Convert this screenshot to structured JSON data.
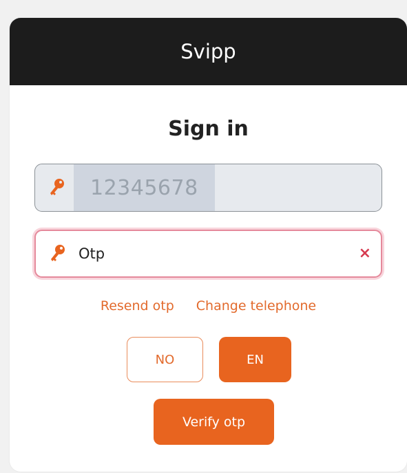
{
  "header": {
    "app_name": "Svipp"
  },
  "form": {
    "title": "Sign in",
    "phone_value": "12345678",
    "otp_placeholder": "Otp",
    "otp_value": "",
    "clear_symbol": "×"
  },
  "links": {
    "resend": "Resend otp",
    "change_phone": "Change telephone"
  },
  "language": {
    "options": [
      "NO",
      "EN"
    ],
    "selected": "EN"
  },
  "actions": {
    "verify_label": "Verify otp"
  },
  "icons": {
    "field_icon": "key-icon",
    "clear": "close-icon"
  },
  "colors": {
    "accent": "#e8641f",
    "header_bg": "#1c1c1c",
    "error_border": "#e5899b",
    "clear_icon": "#d63b50"
  }
}
